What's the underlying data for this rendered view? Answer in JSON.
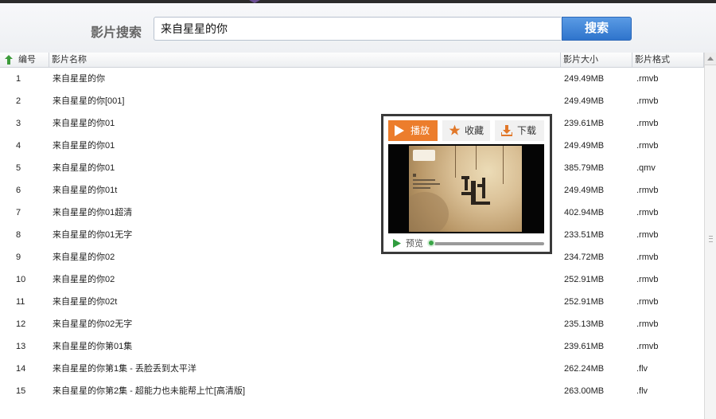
{
  "search": {
    "label": "影片搜索",
    "value": "来自星星的你",
    "button": "搜索"
  },
  "table": {
    "headers": {
      "num": "编号",
      "name": "影片名称",
      "size": "影片大小",
      "format": "影片格式"
    },
    "rows": [
      {
        "num": "1",
        "name": "来自星星的你",
        "size": "249.49MB",
        "format": ".rmvb"
      },
      {
        "num": "2",
        "name": "来自星星的你[001]",
        "size": "249.49MB",
        "format": ".rmvb"
      },
      {
        "num": "3",
        "name": "来自星星的你01",
        "size": "239.61MB",
        "format": ".rmvb"
      },
      {
        "num": "4",
        "name": "来自星星的你01",
        "size": "249.49MB",
        "format": ".rmvb"
      },
      {
        "num": "5",
        "name": "来自星星的你01",
        "size": "385.79MB",
        "format": ".qmv"
      },
      {
        "num": "6",
        "name": "来自星星的你01t",
        "size": "249.49MB",
        "format": ".rmvb"
      },
      {
        "num": "7",
        "name": "来自星星的你01超清",
        "size": "402.94MB",
        "format": ".rmvb"
      },
      {
        "num": "8",
        "name": "来自星星的你01无字",
        "size": "233.51MB",
        "format": ".rmvb"
      },
      {
        "num": "9",
        "name": "来自星星的你02",
        "size": "234.72MB",
        "format": ".rmvb"
      },
      {
        "num": "10",
        "name": "来自星星的你02",
        "size": "252.91MB",
        "format": ".rmvb"
      },
      {
        "num": "11",
        "name": "来自星星的你02t",
        "size": "252.91MB",
        "format": ".rmvb"
      },
      {
        "num": "12",
        "name": "来自星星的你02无字",
        "size": "235.13MB",
        "format": ".rmvb"
      },
      {
        "num": "13",
        "name": "来自星星的你第01集",
        "size": "239.61MB",
        "format": ".rmvb"
      },
      {
        "num": "14",
        "name": "来自星星的你第1集 - 丢脸丢到太平洋",
        "size": "262.24MB",
        "format": ".flv"
      },
      {
        "num": "15",
        "name": "来自星星的你第2集 - 超能力也未能帮上忙[高清版]",
        "size": "263.00MB",
        "format": ".flv"
      }
    ]
  },
  "popup": {
    "play": "播放",
    "favorite": "收藏",
    "download": "下载",
    "preview": "预览",
    "progress": 0.03
  },
  "colors": {
    "accent": "#ec7d2c",
    "search_button": "#2f74cc",
    "progress_knob": "#3aa547"
  },
  "icons": [
    "sort-up-arrow-icon",
    "play-icon",
    "star-icon",
    "download-icon",
    "preview-play-icon",
    "scroll-up-icon"
  ]
}
